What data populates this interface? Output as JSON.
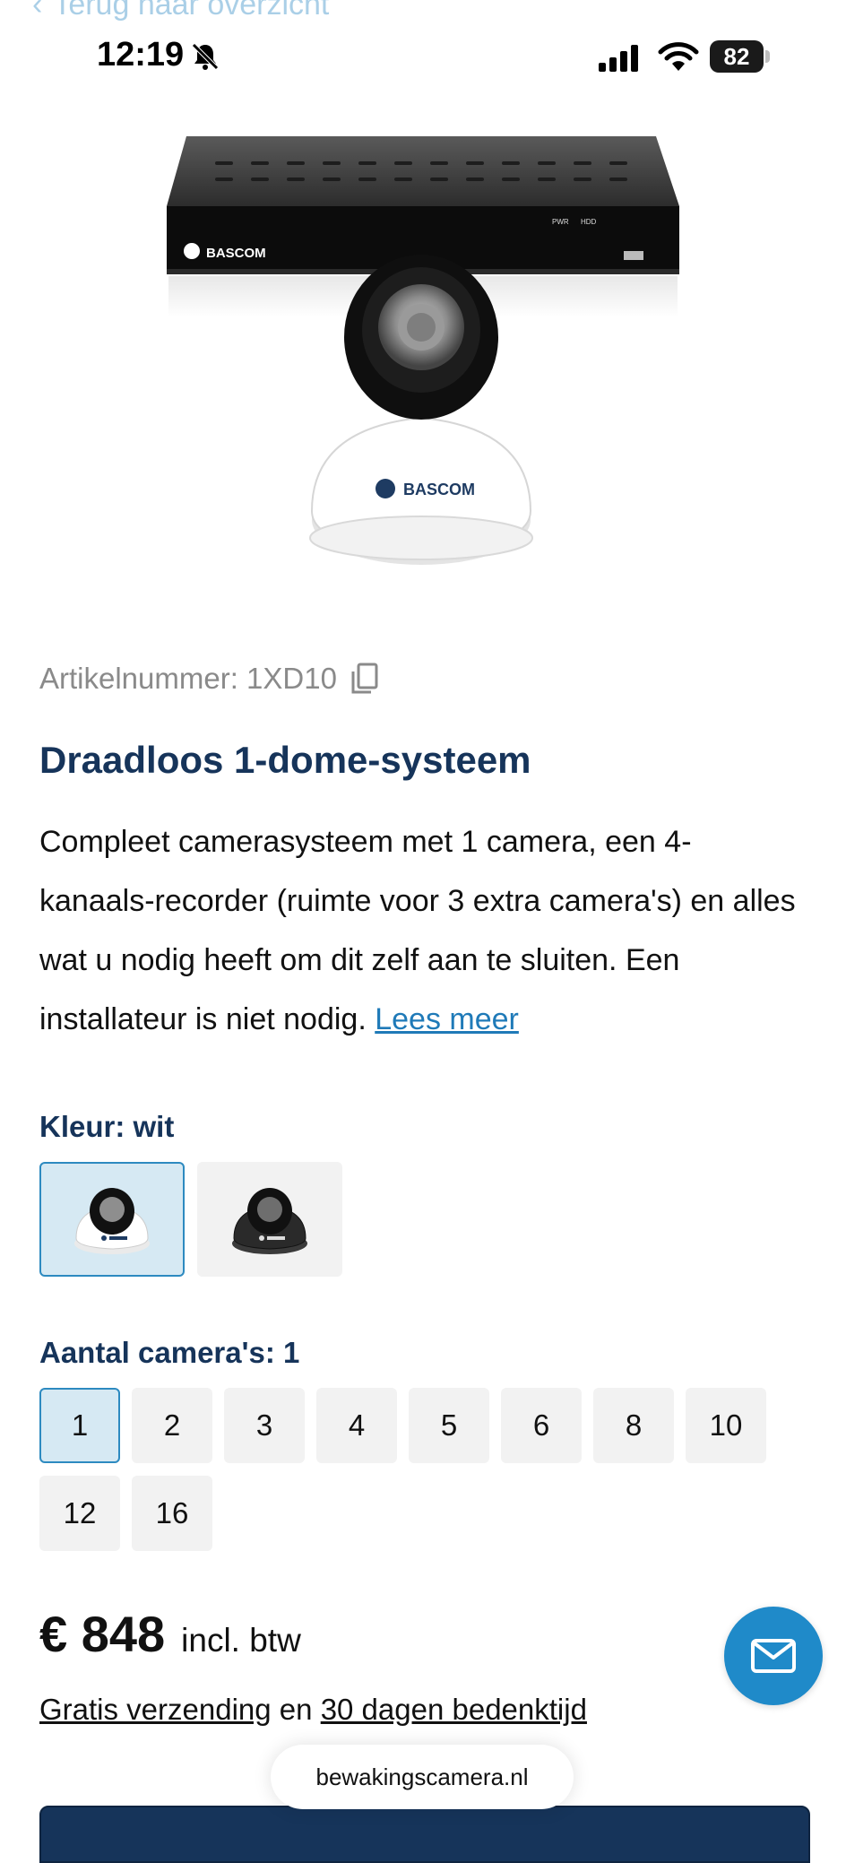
{
  "topbar": {
    "back_label": "Terug naar overzicht"
  },
  "status_bar": {
    "time": "12:19",
    "battery": "82"
  },
  "product": {
    "sku_label": "Artikelnummer: 1XD10",
    "title": "Draadloos 1-dome-systeem",
    "description": "Compleet camerasysteem met 1 camera, een 4-kanaals-recorder (ruimte voor 3 extra camera's) en alles wat u nodig heeft om dit zelf aan te sluiten. Een installateur is niet nodig.",
    "read_more": "Lees meer",
    "brand": "BASCOM",
    "recorder_led_labels": [
      "PWR",
      "HDD"
    ]
  },
  "color": {
    "label": "Kleur: wit",
    "options": [
      {
        "name": "wit",
        "selected": true
      },
      {
        "name": "zwart",
        "selected": false
      }
    ]
  },
  "quantity": {
    "label": "Aantal camera's: 1",
    "options": [
      "1",
      "2",
      "3",
      "4",
      "5",
      "6",
      "8",
      "10",
      "12",
      "16"
    ],
    "selected": "1"
  },
  "price": {
    "amount": "€ 848",
    "tax_note": "incl. btw"
  },
  "shipping": {
    "part1": "Gratis verzending",
    "part2": "en",
    "part3": "30 dagen bedenktijd"
  },
  "browser": {
    "url": "bewakingscamera.nl"
  },
  "colors": {
    "accent": "#1f8ac9",
    "heading": "#16345a",
    "selected_bg": "#d6e9f3"
  },
  "icons": {
    "fab": "mail-icon",
    "copy": "copy-icon",
    "silent": "bell-slash-icon"
  }
}
